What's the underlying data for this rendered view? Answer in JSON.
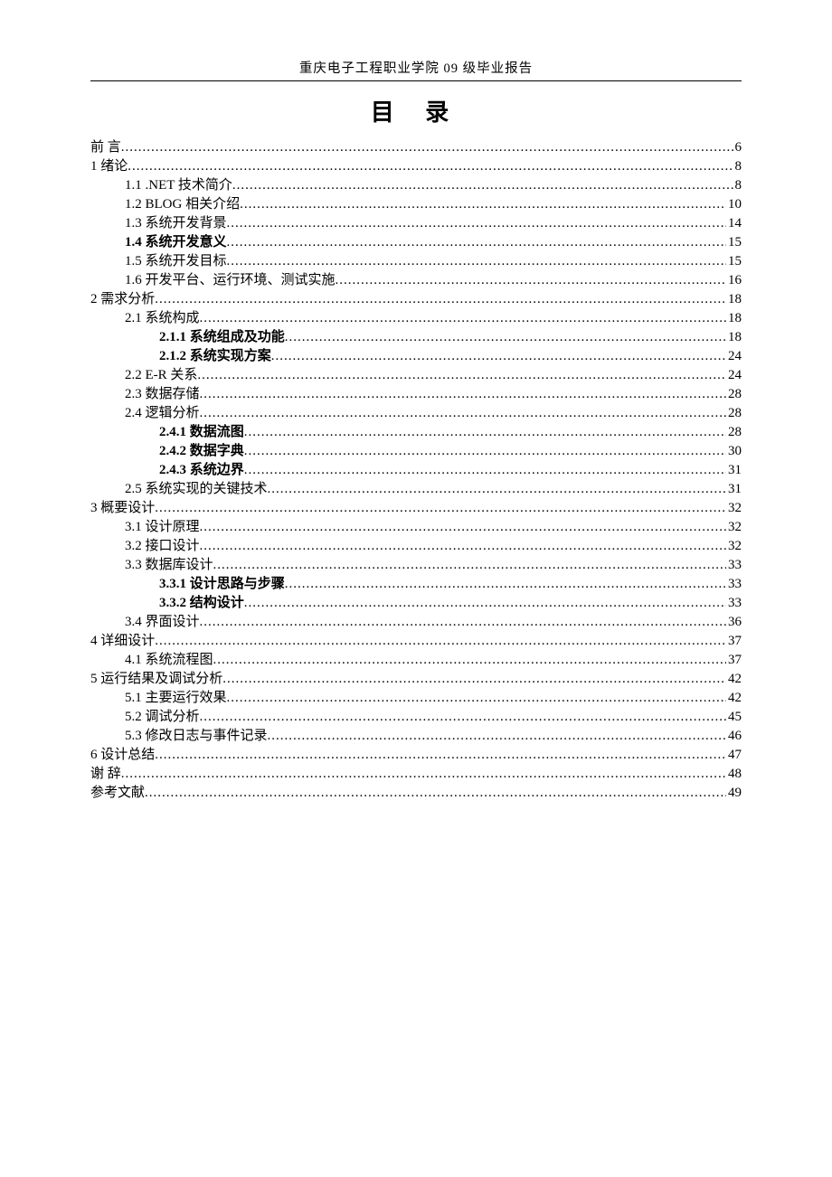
{
  "header": "重庆电子工程职业学院 09 级毕业报告",
  "title": "目 录",
  "toc": [
    {
      "level": 0,
      "bold": false,
      "label": "前   言",
      "page": "6"
    },
    {
      "level": 0,
      "bold": false,
      "label": "1 绪论",
      "page": "8"
    },
    {
      "level": 1,
      "bold": false,
      "label": "1.1 .NET 技术简介",
      "page": "8"
    },
    {
      "level": 1,
      "bold": false,
      "label": "1.2 BLOG 相关介绍",
      "page": "10"
    },
    {
      "level": 1,
      "bold": false,
      "label": "1.3 系统开发背景",
      "page": "14"
    },
    {
      "level": 1,
      "bold": true,
      "label": "1.4 系统开发意义",
      "page": "15"
    },
    {
      "level": 1,
      "bold": false,
      "label": "1.5 系统开发目标",
      "page": "15"
    },
    {
      "level": 1,
      "bold": false,
      "label": "1.6 开发平台、运行环境、测试实施",
      "page": "16"
    },
    {
      "level": 0,
      "bold": false,
      "label": "2 需求分析",
      "page": "18"
    },
    {
      "level": 1,
      "bold": false,
      "label": "2.1 系统构成",
      "page": "18"
    },
    {
      "level": 2,
      "bold": true,
      "label": "2.1.1 系统组成及功能",
      "page": "18"
    },
    {
      "level": 2,
      "bold": true,
      "label": "2.1.2 系统实现方案",
      "page": "24"
    },
    {
      "level": 1,
      "bold": false,
      "label": "2.2 E-R 关系",
      "page": "24"
    },
    {
      "level": 1,
      "bold": false,
      "label": "2.3 数据存储",
      "page": "28"
    },
    {
      "level": 1,
      "bold": false,
      "label": "2.4 逻辑分析",
      "page": "28"
    },
    {
      "level": 2,
      "bold": true,
      "label": "2.4.1 数据流图",
      "page": "28"
    },
    {
      "level": 2,
      "bold": true,
      "label": "2.4.2 数据字典",
      "page": "30"
    },
    {
      "level": 2,
      "bold": true,
      "label": "2.4.3 系统边界",
      "page": "31"
    },
    {
      "level": 1,
      "bold": false,
      "label": "2.5 系统实现的关键技术",
      "page": "31"
    },
    {
      "level": 0,
      "bold": false,
      "label": "3 概要设计",
      "page": "32"
    },
    {
      "level": 1,
      "bold": false,
      "label": "3.1 设计原理",
      "page": "32"
    },
    {
      "level": 1,
      "bold": false,
      "label": "3.2 接口设计",
      "page": "32"
    },
    {
      "level": 1,
      "bold": false,
      "label": "3.3 数据库设计",
      "page": "33"
    },
    {
      "level": 2,
      "bold": true,
      "label": "3.3.1 设计思路与步骤",
      "page": "33"
    },
    {
      "level": 2,
      "bold": true,
      "label": "3.3.2 结构设计",
      "page": "33"
    },
    {
      "level": 1,
      "bold": false,
      "label": "3.4 界面设计",
      "page": "36"
    },
    {
      "level": 0,
      "bold": false,
      "label": "4 详细设计",
      "page": "37"
    },
    {
      "level": 1,
      "bold": false,
      "label": "4.1 系统流程图",
      "page": "37"
    },
    {
      "level": 0,
      "bold": false,
      "label": "5 运行结果及调试分析",
      "page": "42"
    },
    {
      "level": 1,
      "bold": false,
      "label": "5.1 主要运行效果",
      "page": "42"
    },
    {
      "level": 1,
      "bold": false,
      "label": "5.2 调试分析",
      "page": "45"
    },
    {
      "level": 1,
      "bold": false,
      "label": "5.3 修改日志与事件记录",
      "page": "46"
    },
    {
      "level": 0,
      "bold": false,
      "label": "6 设计总结",
      "page": "47"
    },
    {
      "level": 0,
      "bold": false,
      "label": "谢   辞",
      "page": "48"
    },
    {
      "level": 0,
      "bold": false,
      "label": "参考文献",
      "page": "49"
    }
  ]
}
